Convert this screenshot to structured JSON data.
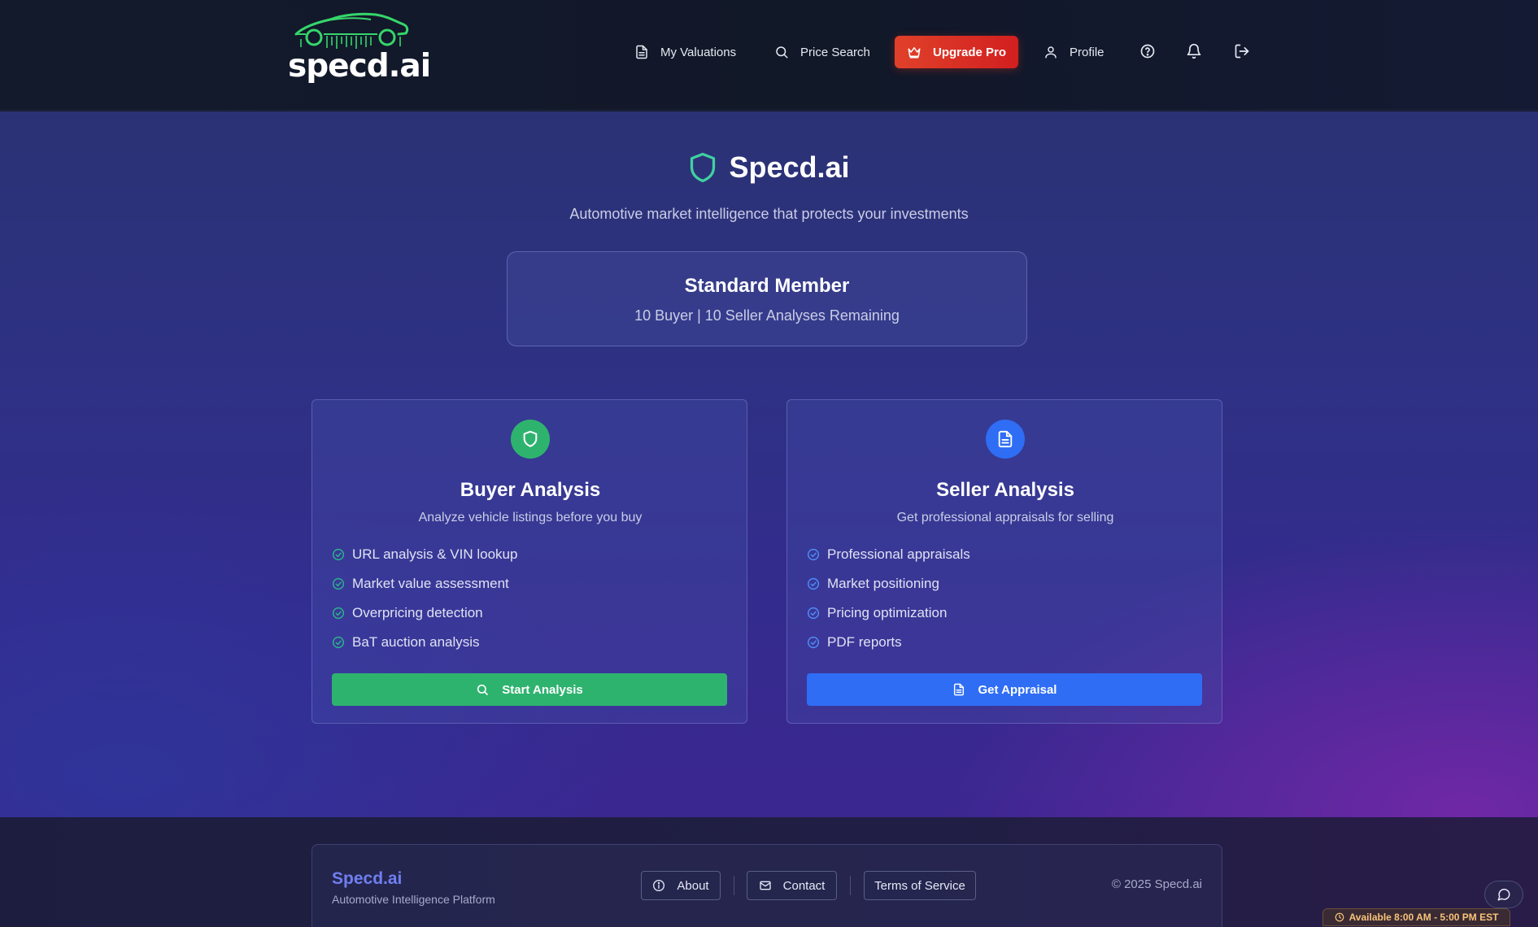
{
  "header": {
    "logo_text": "specd.ai",
    "nav": [
      {
        "label": "My Valuations",
        "icon": "file-text-icon"
      },
      {
        "label": "Price Search",
        "icon": "search-icon"
      },
      {
        "label": "Upgrade Pro",
        "icon": "crown-icon"
      },
      {
        "label": "Profile",
        "icon": "user-icon"
      }
    ],
    "icons": [
      "help-circle-icon",
      "bell-icon",
      "logout-icon"
    ]
  },
  "hero": {
    "title": "Specd.ai",
    "subtitle": "Automotive market intelligence that protects your investments"
  },
  "membership": {
    "tier": "Standard Member",
    "remaining": "10 Buyer | 10 Seller Analyses Remaining"
  },
  "buyer": {
    "title": "Buyer Analysis",
    "subtitle": "Analyze vehicle listings before you buy",
    "features": [
      "URL analysis & VIN lookup",
      "Market value assessment",
      "Overpricing detection",
      "BaT auction analysis"
    ],
    "cta": "Start Analysis",
    "color": "#2eb36f"
  },
  "seller": {
    "title": "Seller Analysis",
    "subtitle": "Get professional appraisals for selling",
    "features": [
      "Professional appraisals",
      "Market positioning",
      "Pricing optimization",
      "PDF reports"
    ],
    "cta": "Get Appraisal",
    "color": "#2f6df5"
  },
  "footer": {
    "brand": "Specd.ai",
    "tagline": "Automotive Intelligence Platform",
    "links": [
      "About",
      "Contact",
      "Terms of Service"
    ],
    "copyright": "© 2025 Specd.ai",
    "availability": "Available 8:00 AM - 5:00 PM EST"
  },
  "colors": {
    "accent_red": "#d9301f",
    "brand_green": "#3fd16f",
    "header_bg": "#131a2c"
  }
}
